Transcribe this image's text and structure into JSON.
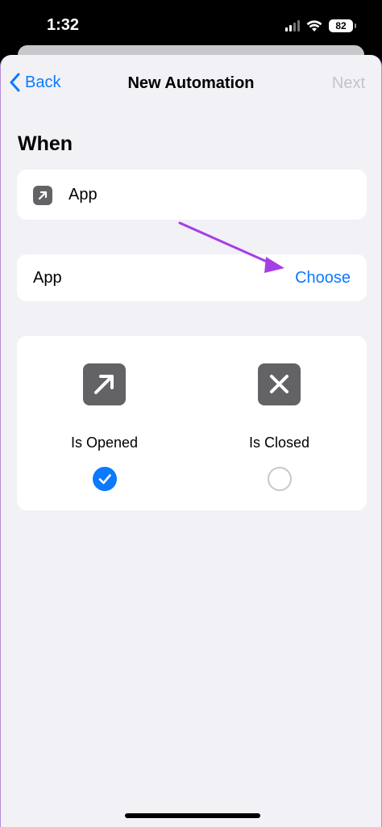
{
  "status_bar": {
    "time": "1:32",
    "battery": "82"
  },
  "nav": {
    "back_label": "Back",
    "title": "New Automation",
    "next_label": "Next"
  },
  "section": {
    "title": "When"
  },
  "when_card": {
    "label": "App",
    "icon": "arrow-up-right-icon"
  },
  "app_row": {
    "label": "App",
    "action": "Choose"
  },
  "options": [
    {
      "label": "Is Opened",
      "icon": "arrow-up-right-icon",
      "selected": true
    },
    {
      "label": "Is Closed",
      "icon": "close-icon",
      "selected": false
    }
  ],
  "colors": {
    "accent": "#0a7aff",
    "annotation": "#a63fe3",
    "sheet_bg": "#f2f1f6",
    "icon_bg": "#636366"
  }
}
